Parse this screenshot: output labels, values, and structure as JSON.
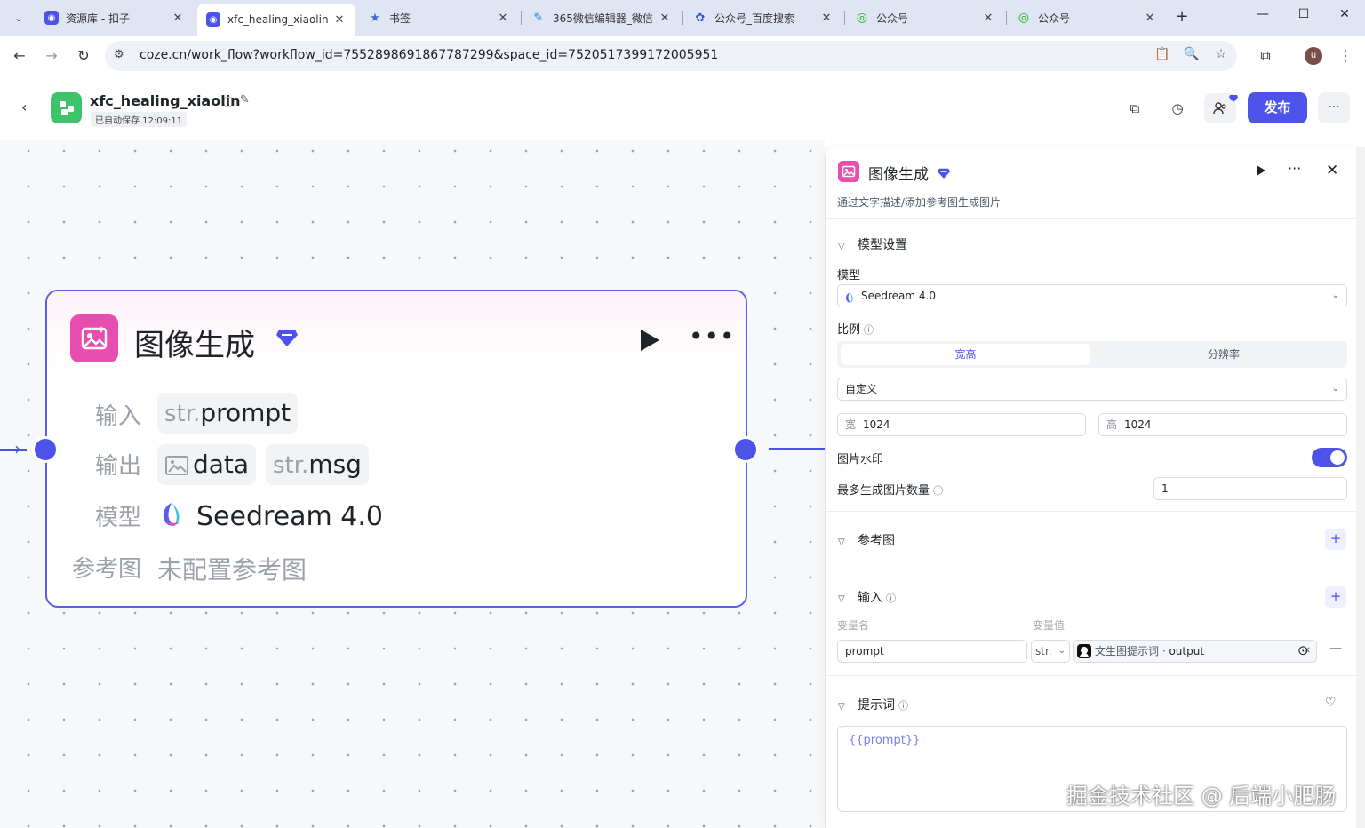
{
  "browser": {
    "tabs": [
      {
        "title": "资源库 - 扣子",
        "active": false
      },
      {
        "title": "xfc_healing_xiaolin",
        "active": true
      },
      {
        "title": "书签",
        "active": false
      },
      {
        "title": "365微信编辑器_微信",
        "active": false
      },
      {
        "title": "公众号_百度搜索",
        "active": false
      },
      {
        "title": "公众号",
        "active": false
      },
      {
        "title": "公众号",
        "active": false
      }
    ],
    "url": "coze.cn/work_flow?workflow_id=7552898691867787299&space_id=7520517399172005951",
    "profile_initial": "u"
  },
  "header": {
    "workflow_name": "xfc_healing_xiaolin",
    "saved_status": "已自动保存 12:09:11",
    "publish_label": "发布"
  },
  "node": {
    "title": "图像生成",
    "input_label": "输入",
    "input_type": "str.",
    "input_name": "prompt",
    "output_label": "输出",
    "output_data_name": "data",
    "output_msg_type": "str.",
    "output_msg_name": "msg",
    "model_label": "模型",
    "model_name": "Seedream 4.0",
    "ref_label": "参考图",
    "ref_value": "未配置参考图"
  },
  "panel": {
    "title": "图像生成",
    "description": "通过文字描述/添加参考图生成图片",
    "model_section": "模型设置",
    "model_label": "模型",
    "model_value": "Seedream 4.0",
    "ratio_label": "比例",
    "ratio_tabs": [
      "宽高",
      "分辨率"
    ],
    "ratio_selected": "自定义",
    "width_prefix": "宽",
    "width_value": "1024",
    "height_prefix": "高",
    "height_value": "1024",
    "watermark_label": "图片水印",
    "watermark_on": true,
    "max_images_label": "最多生成图片数量",
    "max_images_value": "1",
    "ref_section": "参考图",
    "input_section": "输入",
    "var_name_header": "变量名",
    "var_value_header": "变量值",
    "input_var_name": "prompt",
    "input_var_type": "str.",
    "input_ref_node": "文生图提示词",
    "input_ref_sep": " · ",
    "input_ref_field": "output",
    "prompt_section": "提示词",
    "prompt_value": "{{prompt}}"
  },
  "overlay": {
    "watermark_text": "掘金技术社区 @ 后端小肥肠"
  },
  "colors": {
    "accent": "#4d53e8",
    "node_icon": "#e94db0",
    "logo": "#3ec26a"
  }
}
